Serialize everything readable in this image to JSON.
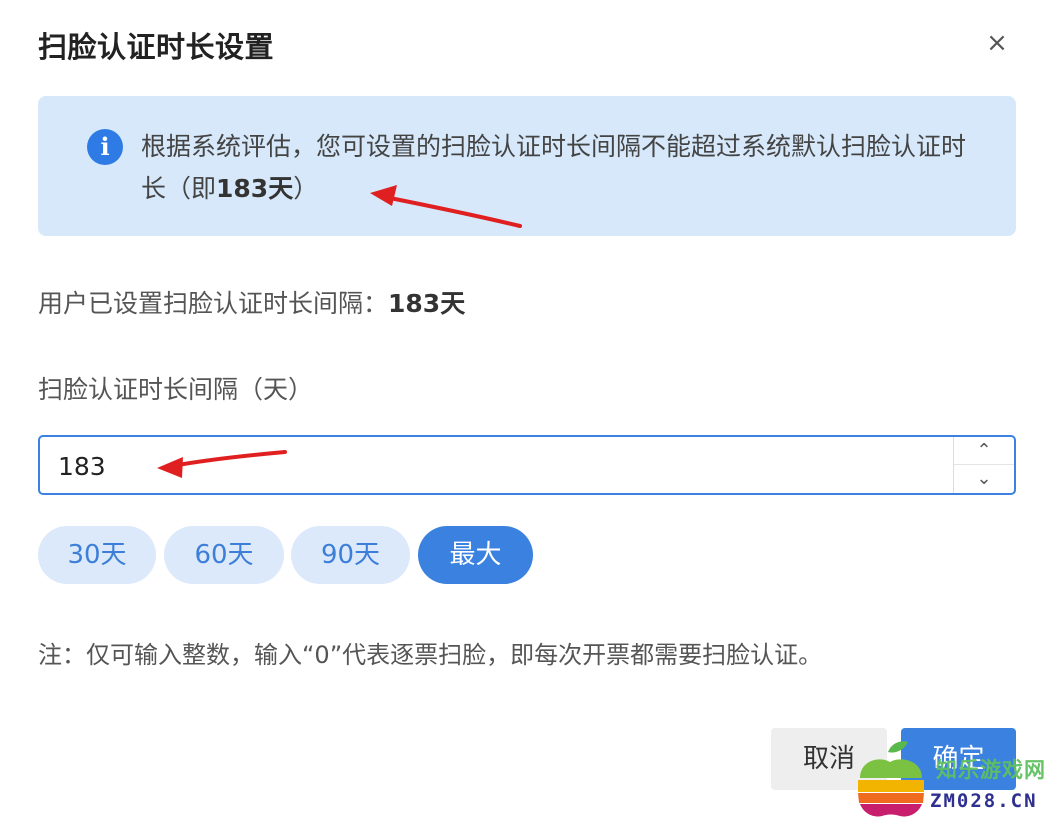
{
  "dialog": {
    "title": "扫脸认证时长设置",
    "close_glyph": "×"
  },
  "notice": {
    "icon_glyph": "i",
    "text_prefix": "根据系统评估，您可设置的扫脸认证时长间隔不能超过系统默认扫脸认证时长（即",
    "text_bold": "183天",
    "text_suffix": "）"
  },
  "current": {
    "label": "用户已设置扫脸认证时长间隔：",
    "value": "183天"
  },
  "field": {
    "label": "扫脸认证时长间隔（天）",
    "value": "183",
    "up_glyph": "⌃",
    "down_glyph": "⌄"
  },
  "presets": [
    {
      "label": "30天",
      "active": false
    },
    {
      "label": "60天",
      "active": false
    },
    {
      "label": "90天",
      "active": false
    },
    {
      "label": "最大",
      "active": true
    }
  ],
  "note": "注：仅可输入整数，输入“0”代表逐票扫脸，即每次开票都需要扫脸认证。",
  "buttons": {
    "cancel": "取消",
    "confirm": "确定"
  },
  "watermark": {
    "text": "知乐游戏网",
    "domain": "ZM028.CN"
  },
  "colors": {
    "accent": "#3b82e0",
    "notice_bg": "#d6e8fa",
    "chip_bg": "#dbe9fb",
    "annotation_arrow": "#e02020"
  }
}
